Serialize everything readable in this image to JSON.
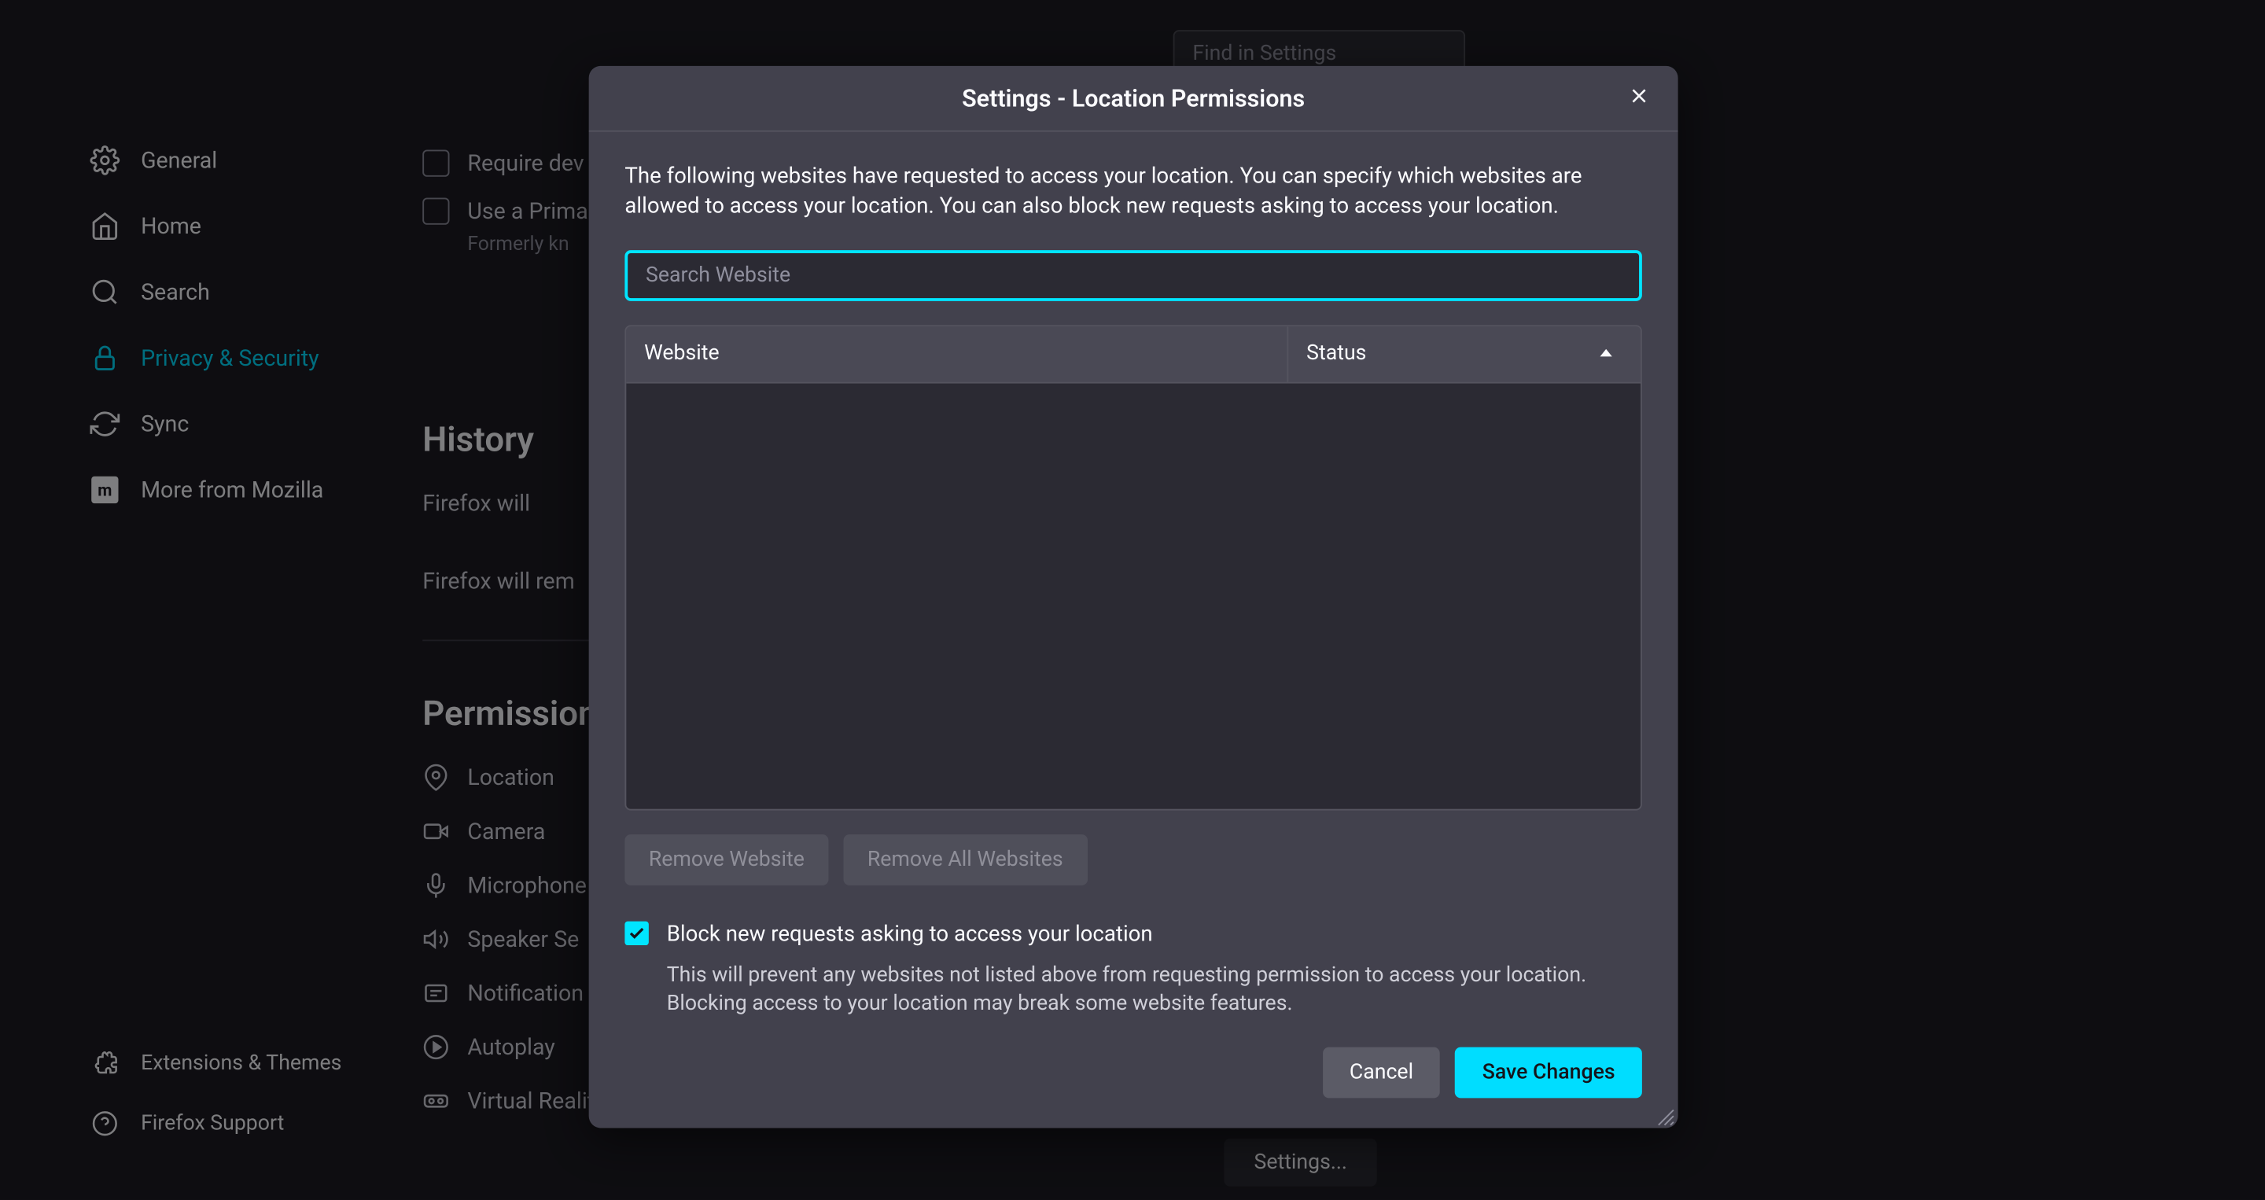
{
  "topSearch": {
    "placeholder": "Find in Settings"
  },
  "sidebar": {
    "items": [
      {
        "label": "General"
      },
      {
        "label": "Home"
      },
      {
        "label": "Search"
      },
      {
        "label": "Privacy & Security"
      },
      {
        "label": "Sync"
      },
      {
        "label": "More from Mozilla"
      }
    ],
    "bottom": [
      {
        "label": "Extensions & Themes"
      },
      {
        "label": "Firefox Support"
      }
    ]
  },
  "main": {
    "requireDev": "Require dev",
    "usePrimary": "Use a Prima",
    "formerly": "Formerly kn",
    "historyTitle": "History",
    "firefoxWill": "Firefox will",
    "firefoxWillRem": "Firefox will rem",
    "permissionsTitle": "Permission",
    "permissions": [
      {
        "label": "Location"
      },
      {
        "label": "Camera"
      },
      {
        "label": "Microphone"
      },
      {
        "label": "Speaker Se"
      },
      {
        "label": "Notification"
      },
      {
        "label": "Autoplay"
      },
      {
        "label": "Virtual Reality"
      }
    ],
    "settingsBtn": "Settings..."
  },
  "dialog": {
    "title": "Settings - Location Permissions",
    "description": "The following websites have requested to access your location. You can specify which websites are allowed to access your location. You can also block new requests asking to access your location.",
    "searchPlaceholder": "Search Website",
    "columns": {
      "website": "Website",
      "status": "Status"
    },
    "removeWebsite": "Remove Website",
    "removeAll": "Remove All Websites",
    "blockLabel": "Block new requests asking to access your location",
    "blockDescription": "This will prevent any websites not listed above from requesting permission to access your location. Blocking access to your location may break some website features.",
    "cancel": "Cancel",
    "save": "Save Changes"
  }
}
